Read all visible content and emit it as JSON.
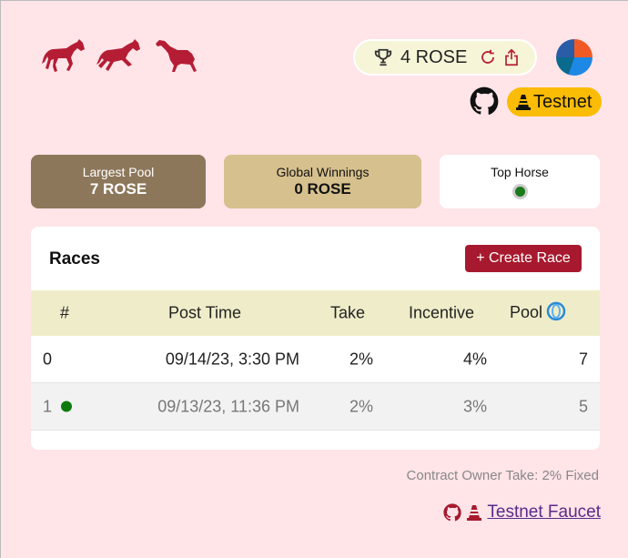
{
  "header": {
    "balance": {
      "amount": "4 ROSE",
      "icons": [
        "trophy-icon",
        "refresh-icon",
        "share-icon"
      ]
    },
    "network_badge": "Testnet",
    "icons": [
      "horse-icon",
      "github-icon",
      "traffic-cone-icon",
      "avatar"
    ]
  },
  "stats": {
    "largest_pool": {
      "label": "Largest Pool",
      "value": "7 ROSE"
    },
    "global_winnings": {
      "label": "Global Winnings",
      "value": "0 ROSE"
    },
    "top_horse": {
      "label": "Top Horse",
      "color": "#1a7a1a"
    }
  },
  "races": {
    "title": "Races",
    "create_label": "+ Create Race",
    "columns": [
      "#",
      "Post Time",
      "Take",
      "Incentive",
      "Pool"
    ],
    "rows": [
      {
        "id": "0",
        "post_time": "09/14/23, 3:30 PM",
        "take": "2%",
        "incentive": "4%",
        "pool": "7",
        "winner_dot": false
      },
      {
        "id": "1",
        "post_time": "09/13/23, 11:36 PM",
        "take": "2%",
        "incentive": "3%",
        "pool": "5",
        "winner_dot": true
      }
    ]
  },
  "footer": {
    "owner_take": "Contract Owner Take: 2% Fixed",
    "faucet_link": "Testnet Faucet"
  },
  "colors": {
    "background": "#ffe4e8",
    "accent": "#a7192e",
    "testnet": "#fbbc05",
    "pool_card": "#8d775b",
    "winnings_card": "#d6c08d",
    "table_header": "#efedc9"
  }
}
